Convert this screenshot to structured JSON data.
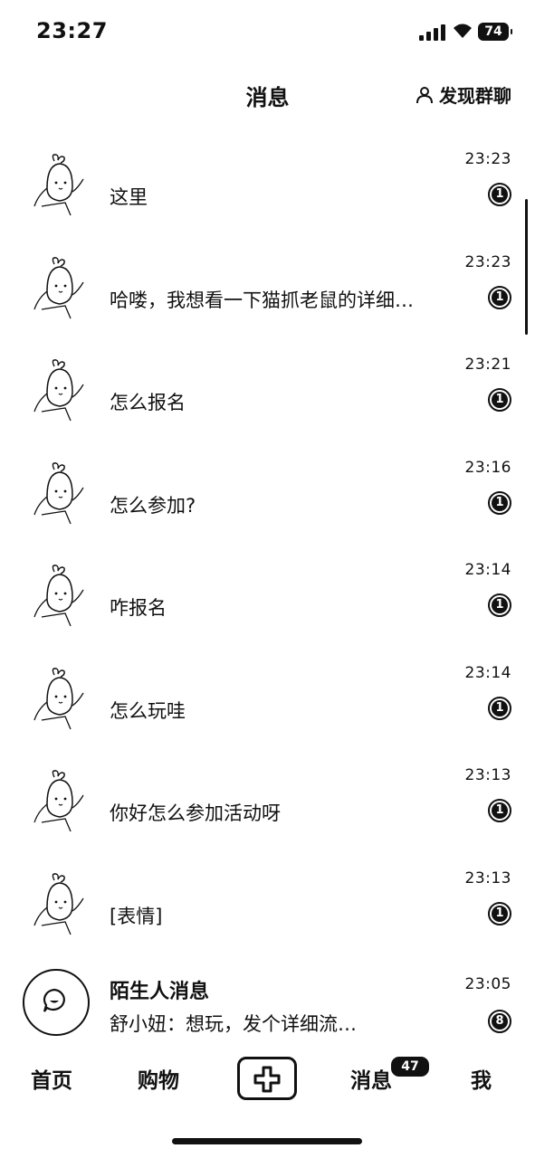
{
  "status_bar": {
    "time": "23:27",
    "battery": "74"
  },
  "header": {
    "title": "消息",
    "discover_label": "发现群聊"
  },
  "conversations": [
    {
      "message": "这里",
      "time": "23:23",
      "badge": "1"
    },
    {
      "message": "哈喽，我想看一下猫抓老鼠的详细…",
      "time": "23:23",
      "badge": "1"
    },
    {
      "message": "怎么报名",
      "time": "23:21",
      "badge": "1"
    },
    {
      "message": "怎么参加?",
      "time": "23:16",
      "badge": "1"
    },
    {
      "message": "咋报名",
      "time": "23:14",
      "badge": "1"
    },
    {
      "message": "怎么玩哇",
      "time": "23:14",
      "badge": "1"
    },
    {
      "message": "你好怎么参加活动呀",
      "time": "23:13",
      "badge": "1"
    },
    {
      "message": "[表情]",
      "time": "23:13",
      "badge": "1"
    }
  ],
  "stranger": {
    "name": "陌生人消息",
    "preview": "舒小妞：想玩，发个详细流…",
    "time": "23:05",
    "badge": "8"
  },
  "tabbar": {
    "home": "首页",
    "shop": "购物",
    "messages": "消息",
    "messages_badge": "47",
    "me": "我"
  },
  "icons": {
    "add": "plus-icon",
    "discover": "person-icon",
    "stranger": "chat-bubble-icon"
  }
}
